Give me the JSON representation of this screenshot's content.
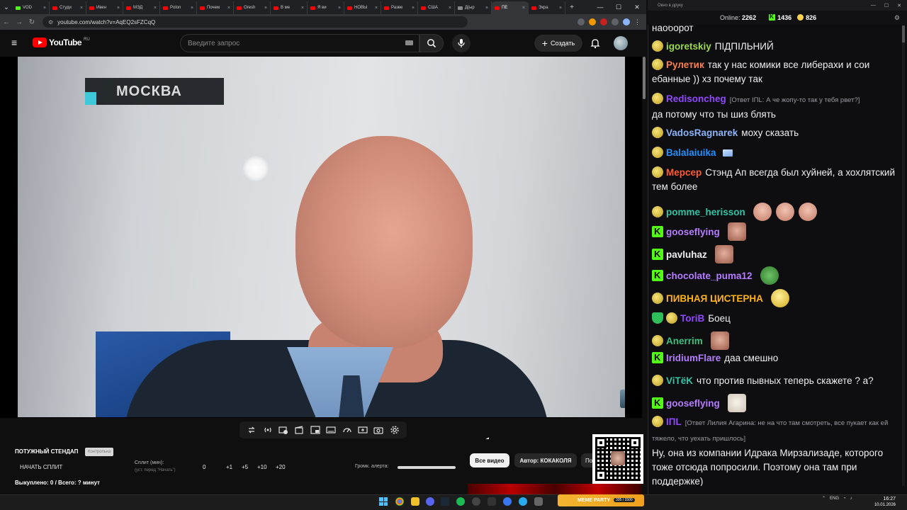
{
  "browser": {
    "tabs": [
      {
        "label": "VOD",
        "icon": "kick"
      },
      {
        "label": "Студи",
        "icon": "yt"
      },
      {
        "label": "Ивен",
        "icon": "yt"
      },
      {
        "label": "МЭД",
        "icon": "yt"
      },
      {
        "label": "Polon",
        "icon": "yt"
      },
      {
        "label": "Почем",
        "icon": "yt"
      },
      {
        "label": "Oresh",
        "icon": "yt"
      },
      {
        "label": "В ме",
        "icon": "yt"
      },
      {
        "label": "Я ви",
        "icon": "yt"
      },
      {
        "label": "НОВЫ",
        "icon": "yt"
      },
      {
        "label": "Разве",
        "icon": "yt"
      },
      {
        "label": "США",
        "icon": "yt"
      },
      {
        "label": "Д(ыр",
        "icon": "g"
      },
      {
        "label": "ПЕ",
        "icon": "yt",
        "active": true
      },
      {
        "label": "Экра",
        "icon": "yt"
      }
    ],
    "url": "youtube.com/watch?v=AqEQ2sFZCqQ"
  },
  "youtube": {
    "logo_text": "YouTube",
    "region": "RU",
    "search_placeholder": "Введите запрос",
    "create_label": "Создать"
  },
  "video": {
    "overlay_text": "МОСКВА"
  },
  "widget": {
    "title": "ПОТУЖНЫЙ СТЕНДАП",
    "badge": "Контролька",
    "start_split": "НАЧАТЬ СПЛИТ",
    "split_label": "Сплит (мин):",
    "split_sub": "(уст. перед \"Начать\")",
    "steps": [
      "0",
      "+1",
      "+5",
      "+10",
      "+20"
    ],
    "alert_volume_label": "Громк. алерта:",
    "bought": "Выкуплено: 0 / Всего: ? минут",
    "chip_all": "Все видео",
    "chip_author": "Автор: КОКАКОЛЯ",
    "chip_more": "По"
  },
  "chat": {
    "window_title": "Окно в друку",
    "online_label": "Online:",
    "online_count": "2262",
    "kick_count": "1436",
    "twitch_count": "826",
    "messages": [
      {
        "badge": "",
        "nick": "",
        "color": "#efeff1",
        "text": "наоборот"
      },
      {
        "badge": "smile",
        "nick": "igoretskiy",
        "color": "#9ad94a",
        "text": "ПІДПІЛЬНИЙ"
      },
      {
        "badge": "smile",
        "nick": "Рулетик",
        "color": "#ff7f50",
        "text": "так у нас комики все либерахи и сои ебанные )) хз почему так"
      },
      {
        "badge": "smile",
        "nick": "Redisoncheg",
        "color": "#9146ff",
        "reply": "[Ответ IПL: А че жопу-то так у тебя рвет?]",
        "text": "да потому что ты шиз блять"
      },
      {
        "badge": "smile",
        "nick": "VadosRagnarek",
        "color": "#8ab4f8",
        "text": "моху сказать"
      },
      {
        "badge": "smile",
        "nick": "Balalaiuika",
        "color": "#1e90ff",
        "text": ""
      },
      {
        "badge": "smile",
        "nick": "Мерсер",
        "color": "#ff5a36",
        "text": "Стэнд Ап всегда был хуйней, а хохлятский тем более"
      },
      {
        "badge": "smile",
        "nick": "pomme_herisson",
        "color": "#2ec4a6",
        "text": ""
      },
      {
        "badge": "kick",
        "nick": "gooseflying",
        "color": "#b57cff",
        "text": ""
      },
      {
        "badge": "kick",
        "nick": "pavluhaz",
        "color": "#efeff1",
        "text": ""
      },
      {
        "badge": "kick",
        "nick": "chocolate_puma12",
        "color": "#b57cff",
        "text": ""
      },
      {
        "badge": "smile",
        "nick": "ПИВНАЯ ЦИСТЕРНА",
        "color": "#ffb31a",
        "text": ""
      },
      {
        "badge": "shield",
        "nick": "ToriB",
        "color": "#9146ff",
        "text": "Боец"
      },
      {
        "badge": "smile",
        "nick": "Anerrim",
        "color": "#3dbf7f",
        "text": ""
      },
      {
        "badge": "kick",
        "nick": "IridiumFlare",
        "color": "#b57cff",
        "text": "даа смешно"
      },
      {
        "badge": "smile",
        "nick": "ViTёK",
        "color": "#2ec4a6",
        "text": "что против пывных теперь скажете ? а?"
      },
      {
        "badge": "kick",
        "nick": "gooseflying",
        "color": "#b57cff",
        "text": ""
      },
      {
        "badge": "smile",
        "nick": "IПL",
        "color": "#9146ff",
        "reply": "[Ответ Лилия Агарина: не на что там смотреть, все пукает как ей тяжело, что уехать пришлось]",
        "text": "Ну, она из компании Идрака Мирзализаде, которого тоже отсюда попросили. Поэтому она там при поддержке)"
      }
    ]
  },
  "taskbar": {
    "lang": "ENG",
    "time": "16:27",
    "date": "10.01.2026",
    "meme_party": "MEME PARTY",
    "meme_progress": "335 / 1500"
  }
}
